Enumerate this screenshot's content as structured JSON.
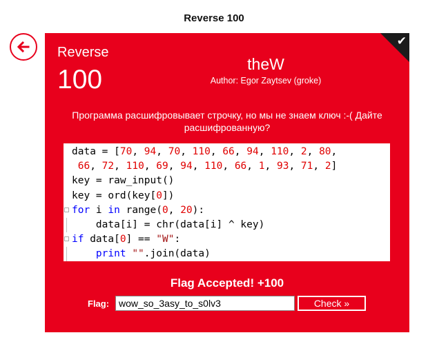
{
  "page": {
    "title": "Reverse 100"
  },
  "colors": {
    "accent": "#e8001c",
    "corner": "#1b1b1b",
    "keyword": "#0000ff",
    "number": "#e00000",
    "string": "#a31515"
  },
  "icons": {
    "back": "arrow-left-circle-icon",
    "solved": "checkmark-icon"
  },
  "challenge": {
    "category": "Reverse",
    "points": "100",
    "name": "theW",
    "author": "Author: Egor Zaytsev (groke)",
    "description": "Программа расшифровывает строчку, но мы не знаем ключ :-( Дайте расшифрованную?",
    "solved": true
  },
  "code": {
    "lines": [
      "data = [70, 94, 70, 110, 66, 94, 110, 2, 80,",
      " 66, 72, 110, 69, 94, 110, 66, 1, 93, 71, 2]",
      "key = raw_input()",
      "key = ord(key[0])",
      "for i in range(0, 20):",
      "    data[i] = chr(data[i] ^ key)",
      "if data[0] == \"W\":",
      "    print \"\".join(data)"
    ]
  },
  "submission": {
    "status": "Flag Accepted! +100",
    "flag_label": "Flag:",
    "flag_value": "wow_so_3asy_to_s0lv3",
    "check_label": "Check »"
  }
}
